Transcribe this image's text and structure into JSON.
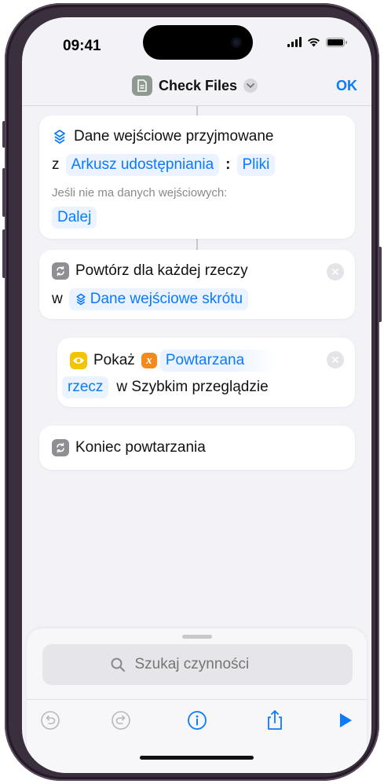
{
  "status": {
    "time": "09:41"
  },
  "nav": {
    "title": "Check Files",
    "ok": "OK"
  },
  "cards": {
    "input": {
      "title": "Dane wejściowe przyjmowane",
      "z": "z",
      "source_token": "Arkusz udostępniania",
      "colon": ":",
      "type_token": "Pliki",
      "no_input_label": "Jeśli nie ma danych wejściowych:",
      "no_input_token": "Dalej"
    },
    "repeat": {
      "title": "Powtórz dla każdej rzeczy",
      "w": "w",
      "token": "Dane wejściowe skrótu"
    },
    "show": {
      "action": "Pokaż",
      "var_token_a": "Powtarzana",
      "var_token_b": "rzecz",
      "suffix": "w Szybkim przeglądzie"
    },
    "end": {
      "title": "Koniec powtarzania"
    }
  },
  "search": {
    "placeholder": "Szukaj czynności"
  },
  "icons": {
    "app": "document-icon",
    "input": "layers-icon",
    "repeat": "repeat-icon",
    "show": "eye-icon",
    "variable": "variable-x-icon",
    "search": "search-icon",
    "undo": "undo-icon",
    "redo": "redo-icon",
    "info": "info-icon",
    "share": "share-icon",
    "play": "play-icon"
  },
  "colors": {
    "accent": "#0a7aff",
    "show_icon": "#f5c400",
    "variable_icon": "#f28a1e",
    "repeat_icon": "#8e8e93"
  }
}
